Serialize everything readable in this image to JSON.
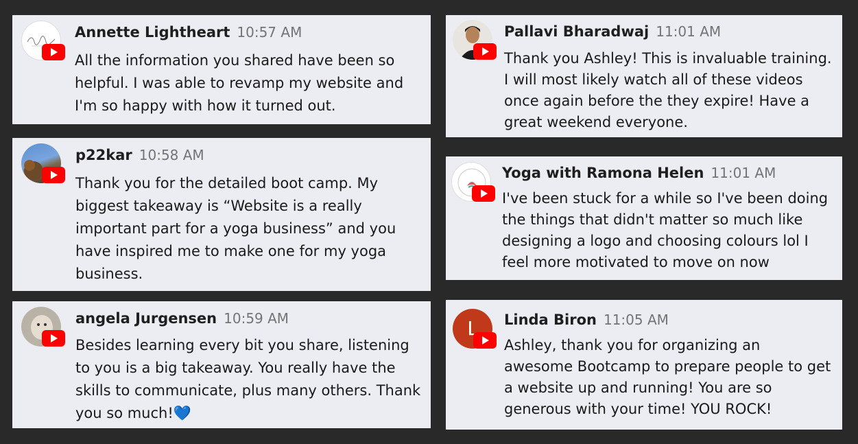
{
  "messages": [
    {
      "author": "Annette Lightheart",
      "time": "10:57 AM",
      "text": "All the information you shared have been so helpful. I was able to revamp my website and I'm so happy with how it turned out.",
      "avatar_text": "Annette Lightheart"
    },
    {
      "author": "p22kar",
      "time": "10:58 AM",
      "text": "Thank you for the detailed boot camp. My biggest takeaway is “Website is a really important part for a yoga business” and you have inspired me to make one for my yoga business."
    },
    {
      "author": "angela Jurgensen",
      "time": "10:59 AM",
      "text": "Besides learning every bit you share, listening to you is a big takeaway. You really have the skills to communicate, plus many others. Thank you so much!💙"
    },
    {
      "author": "Pallavi Bharadwaj",
      "time": "11:01 AM",
      "text": "Thank you Ashley! This is invaluable training. I will most likely watch all of these videos once again before the they expire! Have a great weekend everyone."
    },
    {
      "author": "Yoga with Ramona Helen",
      "time": "11:01 AM",
      "text": "I've been stuck for a while so I've been doing the things that didn't matter so much like designing a logo and choosing colours lol I feel more motivated to move on now"
    },
    {
      "author": "Linda Biron",
      "time": "11:05 AM",
      "text": "Ashley, thank you for organizing an awesome Bootcamp to prepare people to get a website up and running! You are so generous with your time! YOU ROCK!",
      "avatar_letter": "L"
    }
  ],
  "colors": {
    "background": "#292929",
    "card": "#ecedf3",
    "youtube_red": "#ff0000",
    "letter_avatar": "#c0391b"
  },
  "icons": {
    "badge": "youtube-icon"
  }
}
